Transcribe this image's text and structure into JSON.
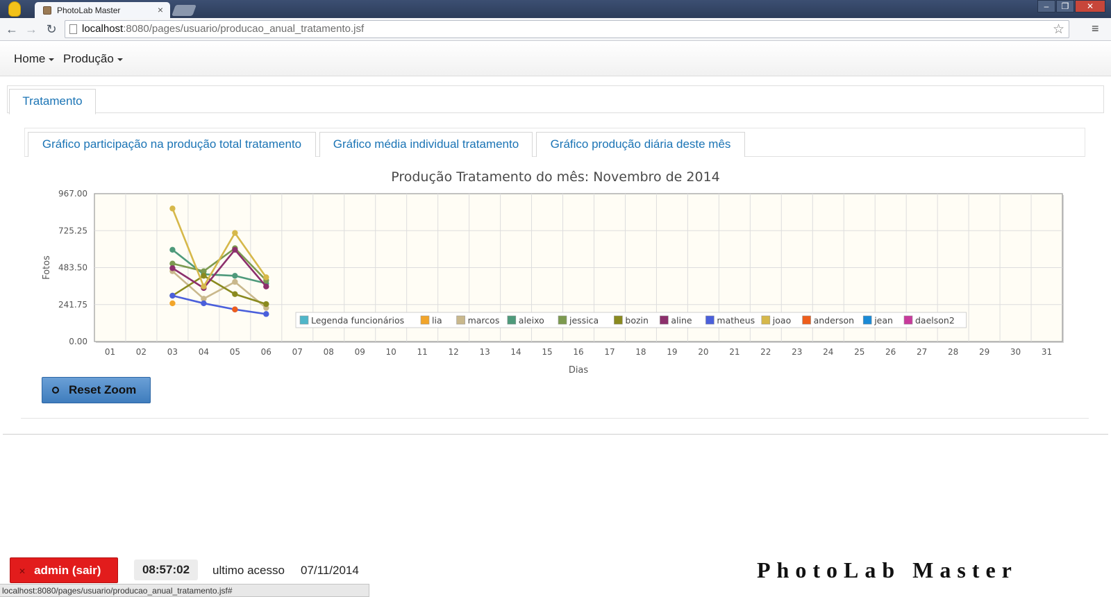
{
  "browser": {
    "tab_title": "PhotoLab Master",
    "url_host": "localhost",
    "url_rest": ":8080/pages/usuario/producao_anual_tratamento.jsf",
    "status_url": "localhost:8080/pages/usuario/producao_anual_tratamento.jsf#"
  },
  "navbar": {
    "items": [
      {
        "label": "Home"
      },
      {
        "label": "Produção"
      }
    ]
  },
  "tabs": {
    "main": "Tratamento",
    "sub": [
      {
        "label": "Gráfico participação na produção total tratamento"
      },
      {
        "label": "Gráfico média individual tratamento"
      },
      {
        "label": "Gráfico produção diária deste mês"
      }
    ]
  },
  "chart_data": {
    "type": "line",
    "title": "Produção Tratamento do mês: Novembro de 2014",
    "xlabel": "Dias",
    "ylabel": "Fotos",
    "ylim": [
      0,
      967
    ],
    "yticks": [
      "0.00",
      "241.75",
      "483.50",
      "725.25",
      "967.00"
    ],
    "categories": [
      "01",
      "02",
      "03",
      "04",
      "05",
      "06",
      "07",
      "08",
      "09",
      "10",
      "11",
      "12",
      "13",
      "14",
      "15",
      "16",
      "17",
      "18",
      "19",
      "20",
      "21",
      "22",
      "23",
      "24",
      "25",
      "26",
      "27",
      "28",
      "29",
      "30",
      "31"
    ],
    "legend": {
      "title": "Legenda funcionários",
      "placement": "bottom-center"
    },
    "grid": true,
    "series": [
      {
        "name": "lia",
        "color": "#f2a52a",
        "x": [
          3
        ],
        "values": [
          250
        ]
      },
      {
        "name": "marcos",
        "color": "#c9b88c",
        "x": [
          3,
          4,
          5,
          6
        ],
        "values": [
          460,
          280,
          390,
          220
        ]
      },
      {
        "name": "aleixo",
        "color": "#4e9a7b",
        "x": [
          3,
          4,
          5,
          6
        ],
        "values": [
          600,
          440,
          430,
          380
        ]
      },
      {
        "name": "jessica",
        "color": "#7c9a4f",
        "x": [
          3,
          4,
          5,
          6
        ],
        "values": [
          510,
          460,
          610,
          400
        ]
      },
      {
        "name": "bozin",
        "color": "#8a8a1f",
        "x": [
          3,
          4,
          5,
          6
        ],
        "values": [
          300,
          430,
          310,
          245
        ]
      },
      {
        "name": "aline",
        "color": "#8c2f6c",
        "x": [
          3,
          4,
          5,
          6
        ],
        "values": [
          480,
          350,
          600,
          360
        ]
      },
      {
        "name": "matheus",
        "color": "#4a5fdb",
        "x": [
          3,
          4,
          5,
          6
        ],
        "values": [
          300,
          250,
          210,
          180
        ]
      },
      {
        "name": "joao",
        "color": "#d6b84a",
        "x": [
          3,
          4,
          5,
          6
        ],
        "values": [
          870,
          360,
          710,
          420
        ]
      },
      {
        "name": "anderson",
        "color": "#ee5e1c",
        "x": [
          5
        ],
        "values": [
          210
        ]
      },
      {
        "name": "jean",
        "color": "#1a8ad6",
        "x": [],
        "values": []
      },
      {
        "name": "daelson2",
        "color": "#c83a9c",
        "x": [],
        "values": []
      }
    ]
  },
  "reset_zoom": {
    "label": "Reset Zoom"
  },
  "footer": {
    "admin_label": "admin (sair)",
    "clock": "08:57:02",
    "last_access_label": "ultimo acesso",
    "last_access_date": "07/11/2014",
    "brand": "PhotoLab Master"
  }
}
